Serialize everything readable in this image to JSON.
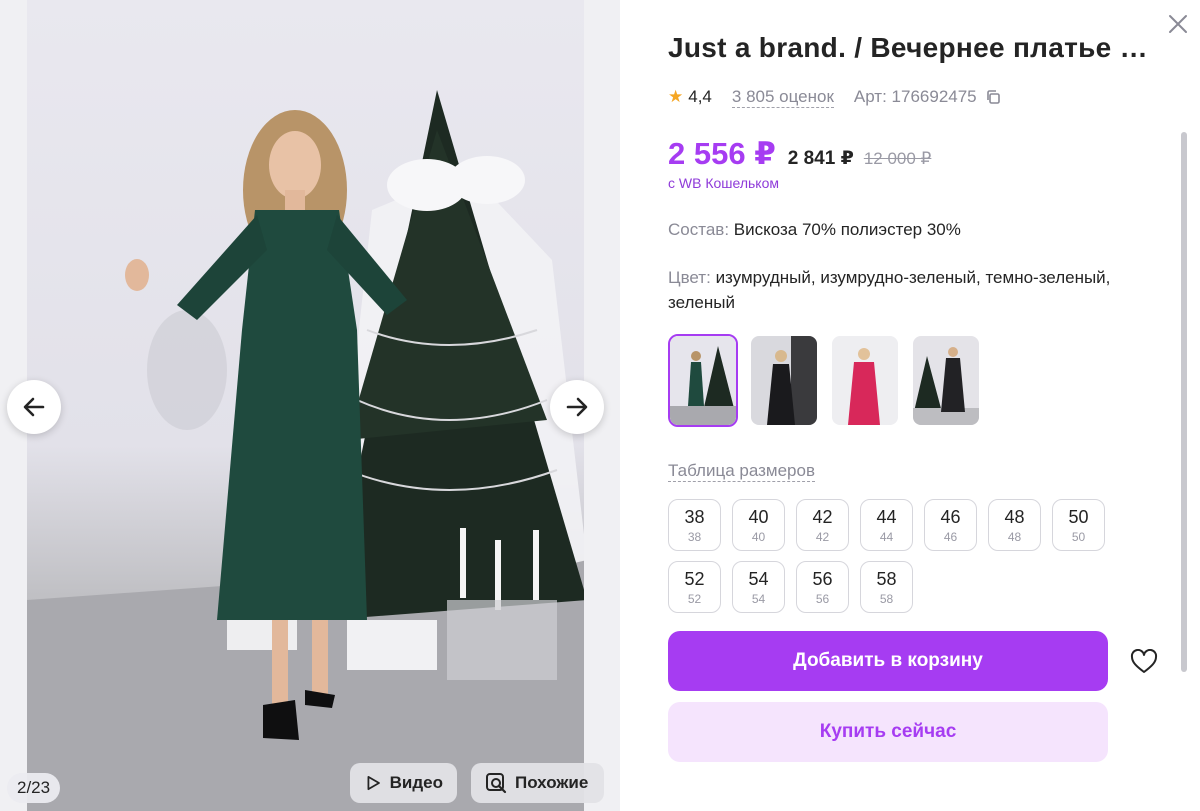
{
  "product": {
    "title": "Just a brand. / Вечернее платье п…",
    "rating": "4,4",
    "reviews": "3 805 оценок",
    "article": "Арт: 176692475"
  },
  "price": {
    "current": "2 556 ₽",
    "without_wallet": "2 841 ₽",
    "old": "12 000 ₽",
    "wallet_note": "с WB Кошельком"
  },
  "specs": {
    "composition_label": "Состав:",
    "composition_value": "Вискоза 70% полиэстер 30%",
    "color_label": "Цвет:",
    "color_value": "изумрудный, изумрудно-зеленый, темно-зеленый, зеленый"
  },
  "swatches": [
    {
      "icon": "green-dress-thumbnail",
      "accent": "#1f4a3e",
      "selected": true
    },
    {
      "icon": "black-dress-thumbnail",
      "accent": "#1a1a1d",
      "selected": false
    },
    {
      "icon": "pink-dress-thumbnail",
      "accent": "#d8285a",
      "selected": false
    },
    {
      "icon": "black-lace-dress-thumbnail",
      "accent": "#222225",
      "selected": false
    }
  ],
  "size_table_label": "Таблица размеров",
  "sizes": [
    {
      "label": "38",
      "ru": "38"
    },
    {
      "label": "40",
      "ru": "40"
    },
    {
      "label": "42",
      "ru": "42"
    },
    {
      "label": "44",
      "ru": "44"
    },
    {
      "label": "46",
      "ru": "46"
    },
    {
      "label": "48",
      "ru": "48"
    },
    {
      "label": "50",
      "ru": "50"
    },
    {
      "label": "52",
      "ru": "52"
    },
    {
      "label": "54",
      "ru": "54"
    },
    {
      "label": "56",
      "ru": "56"
    },
    {
      "label": "58",
      "ru": "58"
    }
  ],
  "actions": {
    "add_to_cart": "Добавить в корзину",
    "buy_now": "Купить сейчас"
  },
  "gallery": {
    "counter": "2/23",
    "video_label": "Видео",
    "similar_label": "Похожие"
  },
  "colors": {
    "accent": "#a63cf2",
    "accent_light": "#f5e4fd",
    "wallet_text": "#8f3bd9",
    "star": "#f5a623"
  }
}
